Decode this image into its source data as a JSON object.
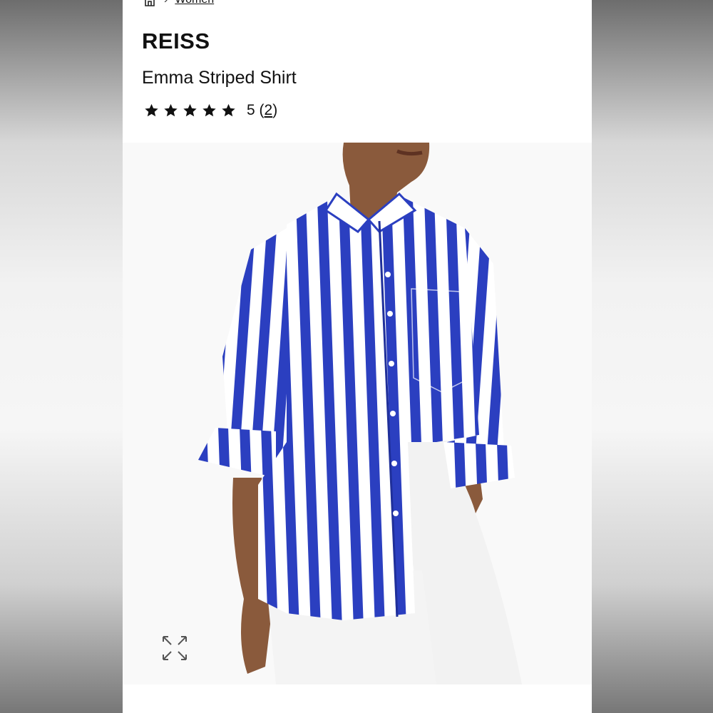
{
  "breadcrumb": {
    "home_icon": "home-icon",
    "separator": "›",
    "current": "Women"
  },
  "product": {
    "brand": "REISS",
    "title": "Emma Striped Shirt",
    "rating": {
      "stars": 5,
      "value_label": "5",
      "count_label": "2"
    },
    "image": {
      "alt": "Model wearing a blue and white vertical striped oversized shirt with white trousers",
      "stripe_color": "#2b3fc0",
      "expand_icon": "expand-icon"
    }
  }
}
